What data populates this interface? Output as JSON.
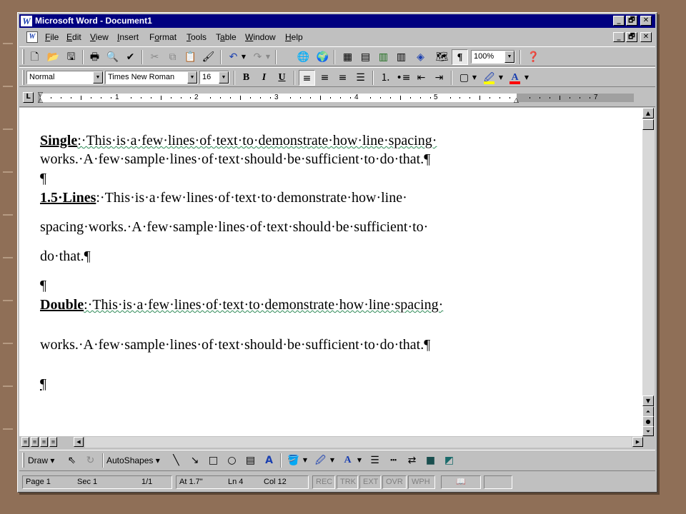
{
  "window": {
    "title": "Microsoft Word - Document1",
    "title_controls": [
      "_",
      "🗗",
      "✕"
    ],
    "doc_controls": [
      "_",
      "🗗",
      "✕"
    ]
  },
  "menu": {
    "items": [
      "File",
      "Edit",
      "View",
      "Insert",
      "Format",
      "Tools",
      "Table",
      "Window",
      "Help"
    ],
    "mnemonics": [
      "F",
      "E",
      "V",
      "I",
      "o",
      "T",
      "a",
      "W",
      "H"
    ]
  },
  "standard_toolbar": {
    "zoom": "100%",
    "icons": [
      "new-document-icon",
      "open-folder-icon",
      "save-disk-icon",
      "print-icon",
      "print-preview-icon",
      "spelling-icon",
      "cut-icon",
      "copy-icon",
      "paste-icon",
      "format-painter-icon",
      "undo-icon",
      "redo-icon",
      "insert-hyperlink-icon",
      "web-toolbar-icon",
      "tables-borders-icon",
      "insert-table-icon",
      "insert-excel-icon",
      "columns-icon",
      "drawing-icon",
      "document-map-icon",
      "show-formatting-icon",
      "office-assistant-icon"
    ]
  },
  "formatting_toolbar": {
    "style": "Normal",
    "font": "Times New Roman",
    "size": "16",
    "bold": "B",
    "italic": "I",
    "underline": "U",
    "icons": [
      "align-left-icon",
      "center-icon",
      "align-right-icon",
      "justify-icon",
      "numbering-icon",
      "bullets-icon",
      "decrease-indent-icon",
      "increase-indent-icon",
      "borders-icon",
      "highlight-icon",
      "font-color-icon"
    ],
    "colors": {
      "highlight": "#ffff00",
      "font_color": "#ff0000"
    }
  },
  "ruler": {
    "tab_selector": "L",
    "numbers": [
      "1",
      "2",
      "3",
      "4",
      "5",
      "6",
      "7"
    ]
  },
  "document": {
    "single": {
      "label": "Single",
      "line1": ":·This·is·a·few·lines·of·text·to·demonstrate·how·line·spacing·",
      "line2": "works.·A·few·sample·lines·of·text·should·be·sufficient·to·do·that.¶"
    },
    "blank1": "¶",
    "one_five": {
      "label": "1.5·Lines",
      "line1": ":·This·is·a·few·lines·of·text·to·demonstrate·how·line·",
      "line2": "spacing·works.·A·few·sample·lines·of·text·should·be·sufficient·to·",
      "line3": "do·that.¶"
    },
    "blank2": "¶",
    "double": {
      "label": "Double",
      "line1": ":·This·is·a·few·lines·of·text·to·demonstrate·how·line·spacing·",
      "line2": "works.·A·few·sample·lines·of·text·should·be·sufficient·to·do·that.¶"
    },
    "blank3": "¶"
  },
  "drawing_toolbar": {
    "draw": "Draw",
    "autoshapes": "AutoShapes",
    "icons": [
      "select-objects-icon",
      "free-rotate-icon",
      "line-icon",
      "arrow-icon",
      "rectangle-icon",
      "oval-icon",
      "text-box-icon",
      "wordart-icon",
      "fill-color-icon",
      "line-color-icon",
      "font-color-icon",
      "line-style-icon",
      "dash-style-icon",
      "arrow-style-icon",
      "shadow-icon",
      "3d-icon"
    ]
  },
  "status_bar": {
    "page": "Page 1",
    "section": "Sec 1",
    "pages": "1/1",
    "at": "At 1.7\"",
    "line": "Ln 4",
    "col": "Col 12",
    "modes": [
      "REC",
      "TRK",
      "EXT",
      "OVR",
      "WPH"
    ]
  }
}
